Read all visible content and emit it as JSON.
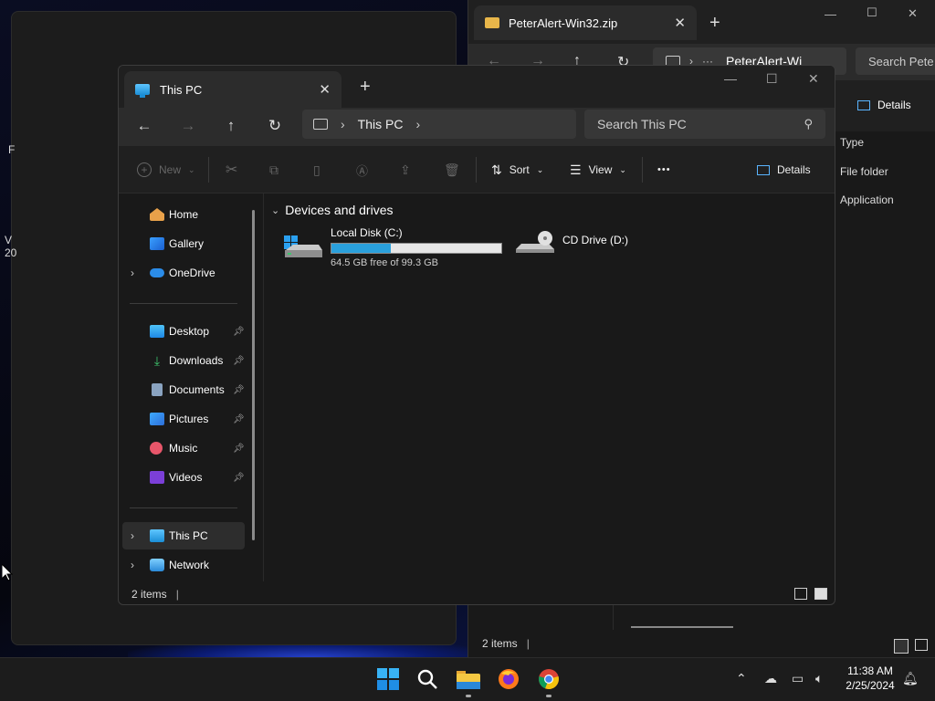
{
  "desktop": {
    "fragments": [
      "F",
      "V",
      "20"
    ]
  },
  "back_window": {
    "tab_title": "PeterAlert-Win32.zip",
    "breadcrumb": "PeterAlert-Wi",
    "search_placeholder": "Search Pete",
    "details_label": "Details",
    "column_header": "Type",
    "type_values": [
      "File folder",
      "Application"
    ],
    "status": "2 items"
  },
  "window": {
    "tab_title": "This PC",
    "breadcrumb": "This PC",
    "search_placeholder": "Search This PC",
    "commands": {
      "new": "New",
      "sort": "Sort",
      "view": "View",
      "more": "•••",
      "details": "Details"
    },
    "sidebar": {
      "top": [
        {
          "label": "Home",
          "expandable": false
        },
        {
          "label": "Gallery",
          "expandable": false
        },
        {
          "label": "OneDrive",
          "expandable": true
        }
      ],
      "quick_access": [
        {
          "label": "Desktop",
          "pinned": true
        },
        {
          "label": "Downloads",
          "pinned": true
        },
        {
          "label": "Documents",
          "pinned": true
        },
        {
          "label": "Pictures",
          "pinned": true
        },
        {
          "label": "Music",
          "pinned": true
        },
        {
          "label": "Videos",
          "pinned": true
        }
      ],
      "bottom": [
        {
          "label": "This PC",
          "selected": true
        },
        {
          "label": "Network",
          "selected": false
        }
      ]
    },
    "group_header": "Devices and drives",
    "drives": [
      {
        "name": "Local Disk (C:)",
        "free_text": "64.5 GB free of 99.3 GB",
        "used_fraction": 0.35
      },
      {
        "name": "CD Drive (D:)"
      }
    ],
    "status": "2 items"
  },
  "taskbar": {
    "apps": [
      "start-icon",
      "search-icon",
      "file-explorer-icon",
      "firefox-icon",
      "chrome-icon"
    ],
    "time": "11:38 AM",
    "date": "2/25/2024"
  },
  "colors": {
    "accent": "#2aa0dc",
    "folder": "#e8b64a",
    "background": "#191919"
  }
}
